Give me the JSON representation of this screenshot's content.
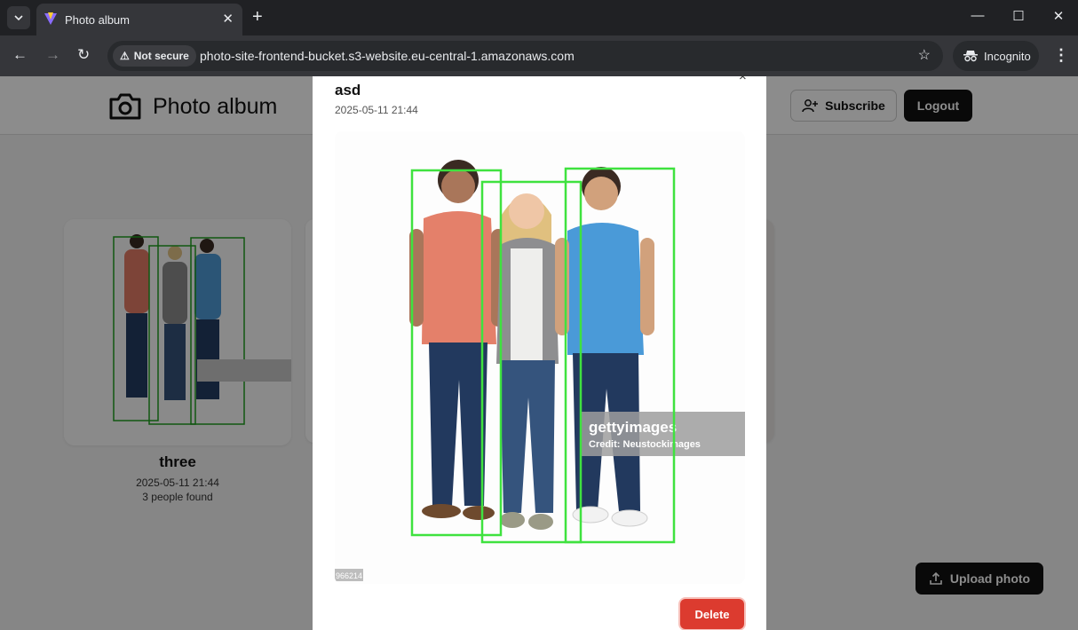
{
  "browser": {
    "tab_title": "Photo album",
    "security_label": "Not secure",
    "url": "photo-site-frontend-bucket.s3-website.eu-central-1.amazonaws.com",
    "incognito_label": "Incognito"
  },
  "header": {
    "brand": "Photo album",
    "subscribe_label": "Subscribe",
    "logout_label": "Logout"
  },
  "album": {
    "cards": [
      {
        "title": "three",
        "date": "2025-05-11 21:44",
        "people": "3 people found"
      }
    ]
  },
  "upload_label": "Upload photo",
  "modal": {
    "title": "asd",
    "date": "2025-05-11 21:44",
    "close_icon": "×",
    "watermark_brand": "gettyimages",
    "watermark_credit": "Credit: Neustockimages",
    "image_id_fragment": "966214",
    "delete_label": "Delete"
  },
  "colors": {
    "detection_box": "#3fe23f",
    "delete": "#dc3b2f",
    "primary": "#111111"
  }
}
